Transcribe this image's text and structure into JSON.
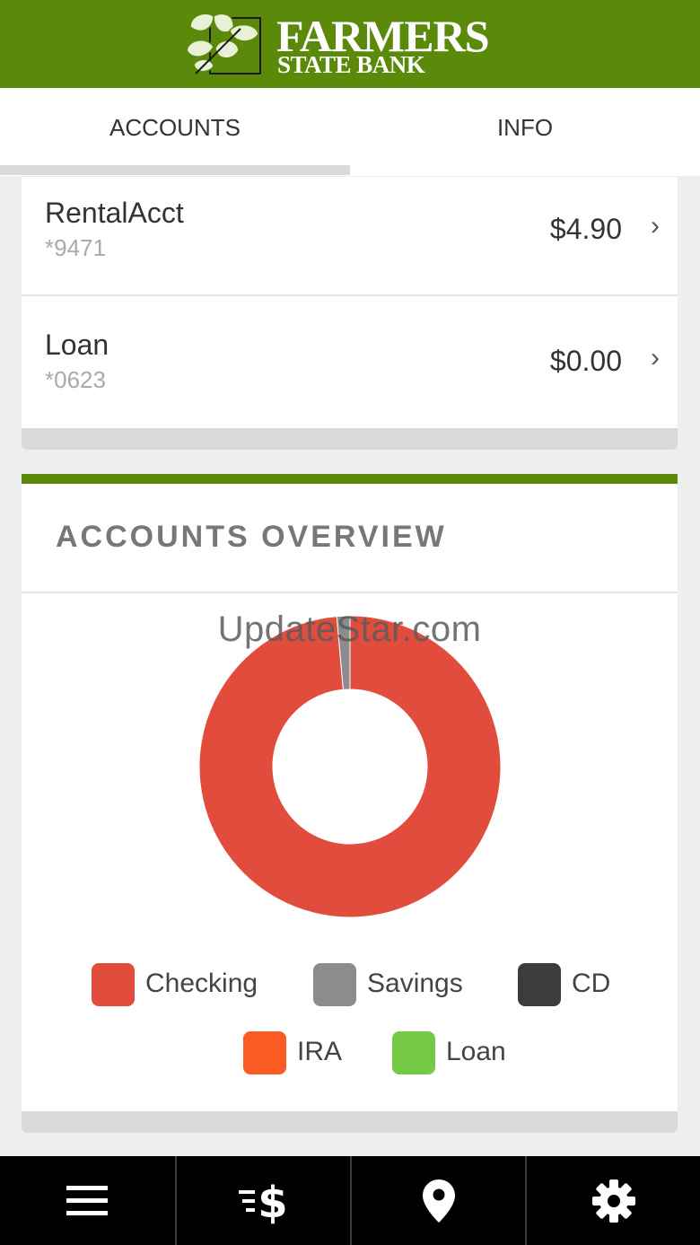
{
  "brand": {
    "line1": "FARMERS",
    "line2": "STATE BANK",
    "color": "#5b8a0a"
  },
  "tabs": [
    {
      "label": "ACCOUNTS",
      "active": true
    },
    {
      "label": "INFO",
      "active": false
    }
  ],
  "accounts": [
    {
      "name": "RentalAcct",
      "number": "*9471",
      "balance": "$4.90"
    },
    {
      "name": "Loan",
      "number": "*0623",
      "balance": "$0.00"
    }
  ],
  "chevron": "›",
  "overview": {
    "title": "ACCOUNTS OVERVIEW",
    "watermark": "UpdateStar.com"
  },
  "chart_data": {
    "type": "pie",
    "categories": [
      "Checking",
      "Savings",
      "CD",
      "IRA",
      "Loan"
    ],
    "values": [
      98.6,
      1.4,
      0,
      0,
      0
    ],
    "colors": [
      "#e24c3c",
      "#8c8c8c",
      "#3c3c3c",
      "#fb5a22",
      "#74c945"
    ],
    "legend": "bottom"
  },
  "nav": [
    {
      "icon": "menu-icon"
    },
    {
      "icon": "transfer-money-icon"
    },
    {
      "icon": "location-pin-icon"
    },
    {
      "icon": "gear-icon"
    }
  ]
}
